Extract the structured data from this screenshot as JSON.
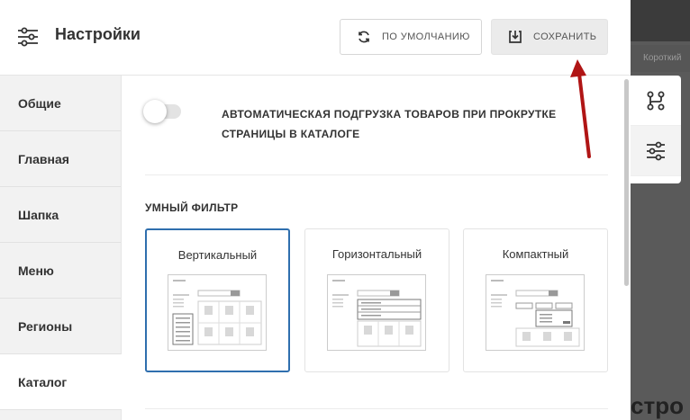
{
  "header": {
    "title": "Настройки",
    "title_icon": "sliders-icon",
    "default_button": {
      "label": "ПО УМОЛЧАНИЮ",
      "icon": "refresh-icon"
    },
    "save_button": {
      "label": "СОХРАНИТЬ",
      "icon": "download-icon"
    }
  },
  "sidebar": {
    "items": [
      {
        "label": "Общие",
        "active": false
      },
      {
        "label": "Главная",
        "active": false
      },
      {
        "label": "Шапка",
        "active": false
      },
      {
        "label": "Меню",
        "active": false
      },
      {
        "label": "Регионы",
        "active": false
      },
      {
        "label": "Каталог",
        "active": true
      }
    ]
  },
  "content": {
    "autoload": {
      "label": "АВТОМАТИЧЕСКАЯ ПОДГРУЗКА ТОВАРОВ ПРИ ПРОКРУТКЕ СТРАНИЦЫ В КАТАЛОГЕ",
      "enabled": false
    },
    "smart_filter": {
      "title": "УМНЫЙ ФИЛЬТР",
      "options": [
        {
          "label": "Вертикальный",
          "selected": true
        },
        {
          "label": "Горизонтальный",
          "selected": false
        },
        {
          "label": "Компактный",
          "selected": false
        }
      ]
    }
  },
  "background": {
    "search_placeholder": "Короткий",
    "big_text": "стро"
  },
  "side_tools": {
    "items": [
      {
        "icon": "branch-icon"
      },
      {
        "icon": "sliders-icon"
      }
    ]
  },
  "colors": {
    "accent": "#2f6fae",
    "arrow": "#b01515"
  }
}
